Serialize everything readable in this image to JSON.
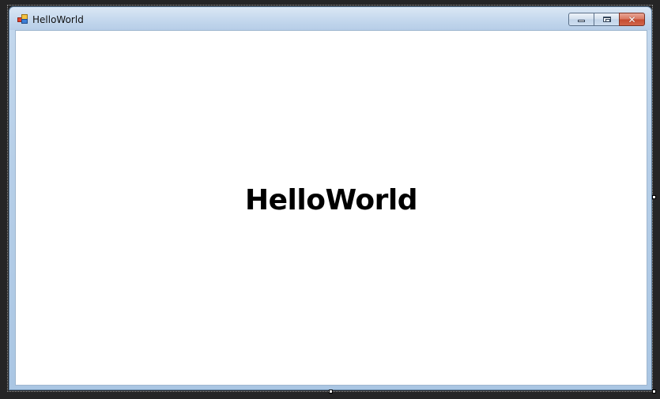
{
  "window": {
    "title": "HelloWorld",
    "icon": "winforms-app-icon",
    "controls": {
      "minimize_icon": "minimize-icon",
      "maximize_icon": "maximize-icon",
      "close_icon": "close-icon",
      "close_glyph": "✕"
    }
  },
  "form": {
    "label_text": "HelloWorld"
  },
  "colors": {
    "client_background": "#ffffff",
    "title_bar": "#c6d9ee",
    "close_button": "#c44a2f",
    "label_text": "#000000"
  }
}
